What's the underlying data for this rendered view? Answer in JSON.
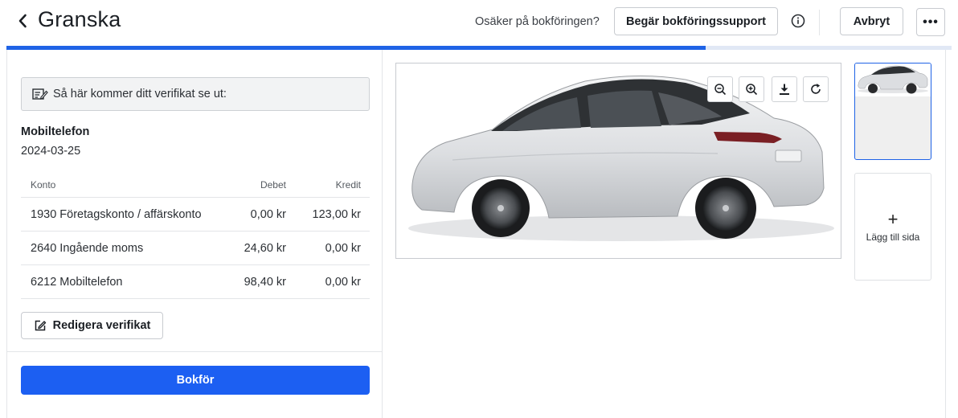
{
  "header": {
    "title": "Granska",
    "unsure_text": "Osäker på bokföringen?",
    "support_button": "Begär bokföringssupport",
    "cancel_button": "Avbryt",
    "more_button": "•••"
  },
  "progress": {
    "fraction": 0.74,
    "color": "#1f63e6"
  },
  "left": {
    "preview_text": "Så här kommer ditt verifikat se ut:",
    "document_name": "Mobiltelefon",
    "document_date": "2024-03-25",
    "table": {
      "headers": {
        "account": "Konto",
        "debit": "Debet",
        "credit": "Kredit"
      },
      "rows": [
        {
          "account": "1930 Företagskonto / affärskonto",
          "debit": "0,00 kr",
          "credit": "123,00 kr"
        },
        {
          "account": "2640 Ingående moms",
          "debit": "24,60 kr",
          "credit": "0,00 kr"
        },
        {
          "account": "6212 Mobiltelefon",
          "debit": "98,40 kr",
          "credit": "0,00 kr"
        }
      ]
    },
    "edit_button": "Redigera verifikat",
    "book_button": "Bokför"
  },
  "viewer": {
    "tools": [
      "zoom-out-icon",
      "zoom-in-icon",
      "download-icon",
      "rotate-icon"
    ]
  },
  "pages": {
    "add_page_label": "Lägg till sida",
    "add_symbol": "+"
  },
  "colors": {
    "accent": "#1c5ff2",
    "border": "#c8cbd0"
  }
}
